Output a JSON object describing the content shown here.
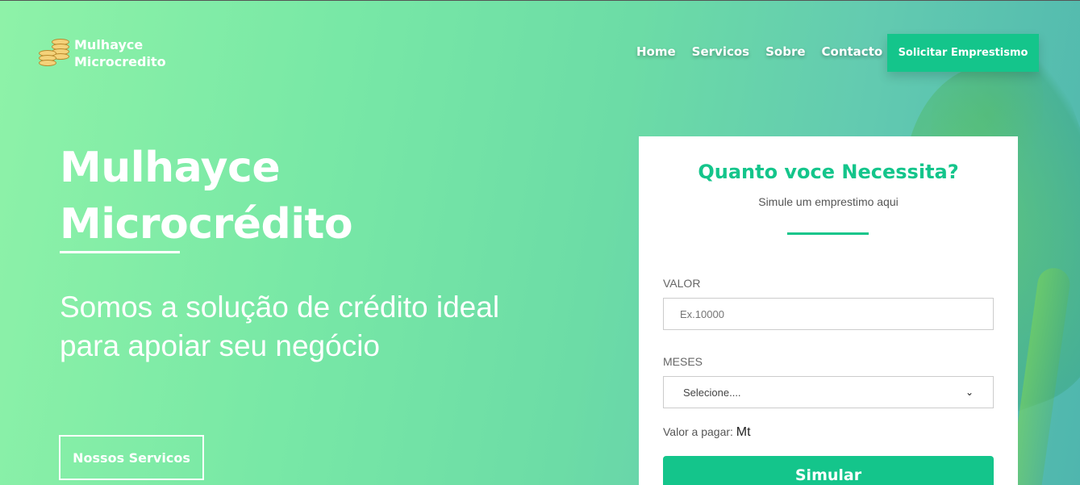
{
  "brand": {
    "name_line1": "Mulhayce",
    "name_line2": "Microcredito"
  },
  "nav": {
    "items": [
      "Home",
      "Servicos",
      "Sobre",
      "Contacto"
    ],
    "cta_label": "Solicitar Emprestismo"
  },
  "hero": {
    "title_line1": "Mulhayce",
    "title_line2": "Microcrédito",
    "subtitle": "Somos a solução de crédito ideal para apoiar seu negócio",
    "services_button": "Nossos Servicos"
  },
  "card": {
    "title": "Quanto voce Necessita?",
    "subtitle": "Simule um emprestimo aqui",
    "valor_label": "VALOR",
    "valor_placeholder": "Ex.10000",
    "meses_label": "MESES",
    "meses_selected": "Selecione....",
    "pay_label": "Valor a pagar:",
    "pay_currency": "Mt",
    "simulate_button": "Simular"
  },
  "colors": {
    "accent": "#14c58b",
    "bg_start": "#8ef2a8",
    "bg_end": "#4fb6ae"
  }
}
